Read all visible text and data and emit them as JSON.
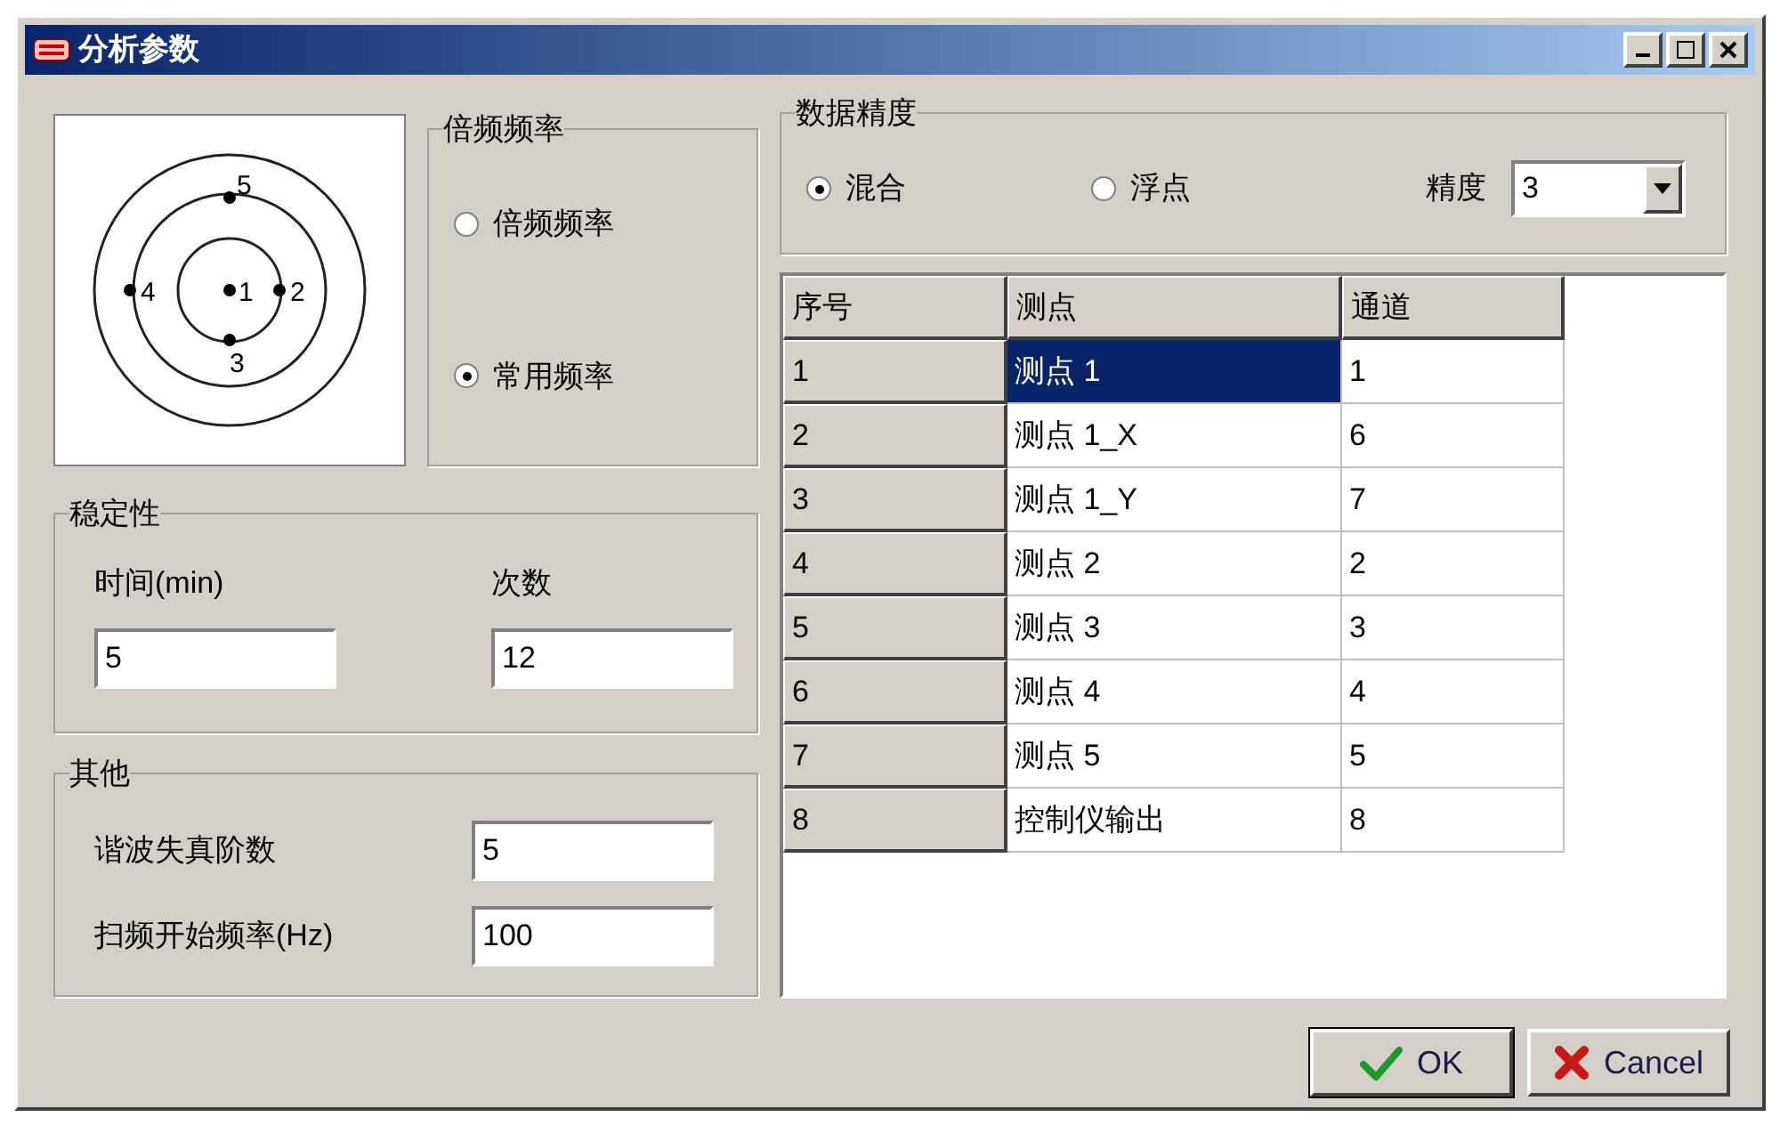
{
  "window": {
    "title": "分析参数"
  },
  "diagram": {
    "points": [
      "1",
      "2",
      "3",
      "4",
      "5"
    ]
  },
  "frequency_group": {
    "title": "倍频频率",
    "options": [
      {
        "label": "倍频频率",
        "selected": false
      },
      {
        "label": "常用频率",
        "selected": true
      }
    ]
  },
  "stability": {
    "title": "稳定性",
    "fields": [
      {
        "label": "时间(min)",
        "value": "5"
      },
      {
        "label": "次数",
        "value": "12"
      }
    ]
  },
  "other": {
    "title": "其他",
    "fields": [
      {
        "label": "谐波失真阶数",
        "value": "5"
      },
      {
        "label": "扫频开始频率(Hz)",
        "value": "100"
      }
    ]
  },
  "precision_group": {
    "title": "数据精度",
    "options": [
      {
        "label": "混合",
        "selected": true
      },
      {
        "label": "浮点",
        "selected": false
      }
    ],
    "precision_label": "精度",
    "precision_value": "3"
  },
  "table": {
    "columns": [
      "序号",
      "测点",
      "通道"
    ],
    "rows": [
      {
        "cells": [
          "1",
          "测点 1",
          "1"
        ],
        "selected": true
      },
      {
        "cells": [
          "2",
          "测点 1_X",
          "6"
        ],
        "selected": false
      },
      {
        "cells": [
          "3",
          "测点 1_Y",
          "7"
        ],
        "selected": false
      },
      {
        "cells": [
          "4",
          "测点 2",
          "2"
        ],
        "selected": false
      },
      {
        "cells": [
          "5",
          "测点 3",
          "3"
        ],
        "selected": false
      },
      {
        "cells": [
          "6",
          "测点 4",
          "4"
        ],
        "selected": false
      },
      {
        "cells": [
          "7",
          "测点 5",
          "5"
        ],
        "selected": false
      },
      {
        "cells": [
          "8",
          "控制仪输出",
          "8"
        ],
        "selected": false
      }
    ]
  },
  "buttons": [
    {
      "label": "OK",
      "kind": "ok"
    },
    {
      "label": "Cancel",
      "kind": "cancel"
    }
  ]
}
